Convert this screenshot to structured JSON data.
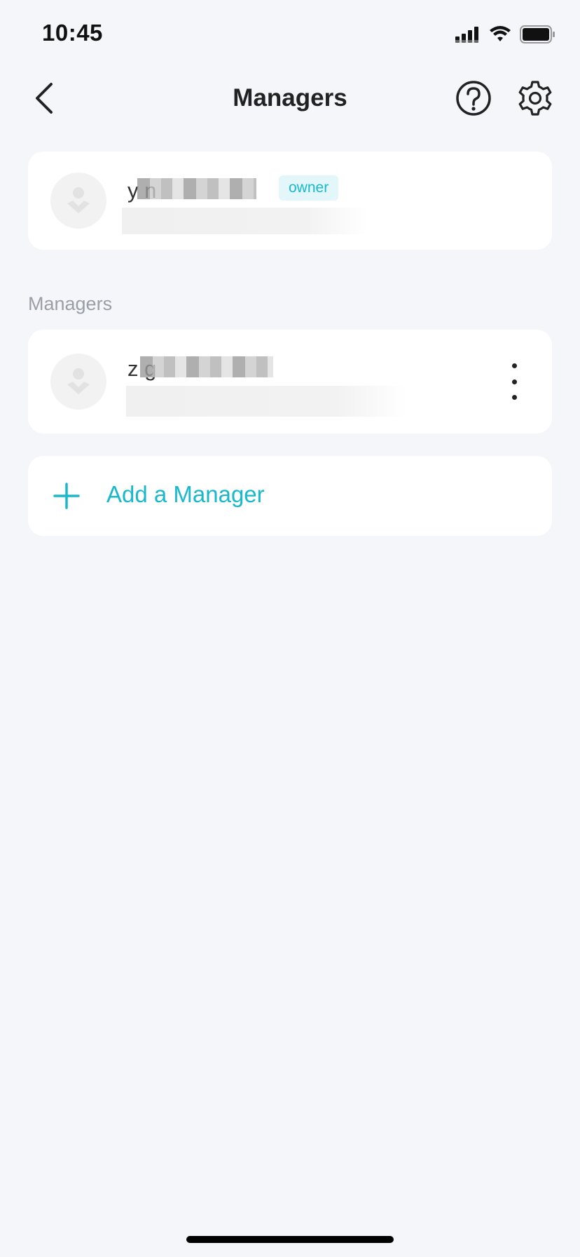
{
  "status_bar": {
    "time": "10:45"
  },
  "header": {
    "title": "Managers",
    "back_icon": "chevron-left-icon",
    "help_icon": "question-circle-icon",
    "settings_icon": "gear-icon"
  },
  "owner": {
    "name": "y         n",
    "badge": "owner"
  },
  "managers_section": {
    "label": "Managers",
    "items": [
      {
        "name": "z            g"
      }
    ]
  },
  "add_manager": {
    "label": "Add a Manager"
  },
  "colors": {
    "accent": "#19b9cc",
    "background": "#f4f6fa",
    "card": "#ffffff",
    "badge_bg": "#e3f7fa"
  }
}
